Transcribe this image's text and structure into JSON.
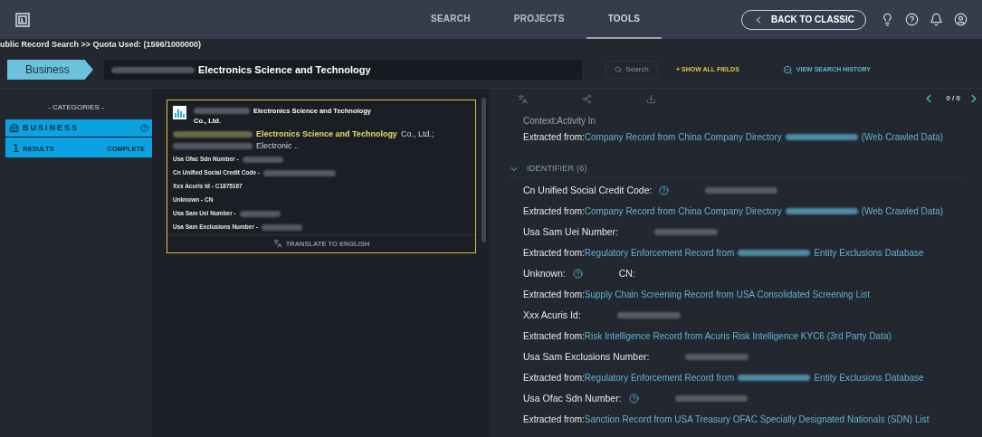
{
  "nav": {
    "tabs": [
      {
        "label": "SEARCH",
        "selected": false
      },
      {
        "label": "PROJECTS",
        "selected": false
      },
      {
        "label": "TOOLS",
        "selected": true
      }
    ],
    "back_button": "BACK TO CLASSIC"
  },
  "breadcrumb": "ublic Record Search >> Quota Used: (1596/1000000)",
  "search": {
    "category": "Business",
    "query": "Electronics Science and Technology",
    "query_redacted": true,
    "search_placeholder": "Search",
    "show_all_fields": "+ SHOW ALL FIELDS",
    "view_history": "VIEW SEARCH HISTORY"
  },
  "categories": {
    "title": "- CATEGORIES -",
    "items": [
      {
        "label": "BUSINESS",
        "count": "1",
        "count_label": "RESULTS",
        "status": "COMPLETE",
        "selected": true
      }
    ]
  },
  "result_card": {
    "title": "Electronics Science and Technology",
    "title_line2": "Co., Ltd.",
    "match": "Electronics Science and Technology",
    "match_suffix": "Co., Ltd.;",
    "match_line2": "Electronic ..",
    "fields": [
      {
        "label": "Usa Ofac Sdn Number -",
        "redacted": true
      },
      {
        "label": "Cn Unified Social Credit Code -",
        "redacted": true
      },
      {
        "label": "Xxx Acuris Id - C1875167",
        "redacted": false
      },
      {
        "label": "Unknown - CN",
        "redacted": false
      },
      {
        "label": "Usa Sam Uei Number -",
        "redacted": true
      },
      {
        "label": "Usa Sam Exclusions Number -",
        "redacted": true
      }
    ],
    "translate": "TRANSLATE TO ENGLISH",
    "selected": true
  },
  "details": {
    "pager": "0 / 0",
    "top_rows": [
      {
        "kind": "text",
        "label": "Context:Activity In"
      },
      {
        "kind": "source",
        "prefix": "Extracted from:",
        "link": "Company Record from China Company Directory",
        "redacted": true,
        "suffix": "(Web Crawled Data)"
      }
    ],
    "section": {
      "title": "IDENTIFIER (6)",
      "expanded": true
    },
    "rows": [
      {
        "kind": "field",
        "label": "Cn Unified Social Credit Code:",
        "help": true,
        "redacted": true
      },
      {
        "kind": "source",
        "prefix": "Extracted from:",
        "link": "Company Record from China Company Directory",
        "redacted": true,
        "suffix": "(Web Crawled Data)"
      },
      {
        "kind": "field",
        "label": "Usa Sam Uei Number:",
        "help": false,
        "redacted": true
      },
      {
        "kind": "source",
        "prefix": "Extracted from:",
        "link": "Regulatory Enforcement Record from",
        "redacted": true,
        "suffix": "Entity Exclusions Database"
      },
      {
        "kind": "field",
        "label": "Unknown:",
        "help": true,
        "redacted": false,
        "value": "CN:"
      },
      {
        "kind": "source",
        "prefix": "Extracted from:",
        "link": "Supply Chain Screening Record from USA Consolidated Screening List",
        "redacted": false
      },
      {
        "kind": "field",
        "label": "Xxx Acuris Id:",
        "help": false,
        "redacted": true
      },
      {
        "kind": "source",
        "prefix": "Extracted from:",
        "link": "Risk Intelligence Record from Acuris Risk Intelligence KYC6 (3rd Party Data)",
        "redacted": false
      },
      {
        "kind": "field",
        "label": "Usa Sam Exclusions Number:",
        "help": false,
        "redacted": true
      },
      {
        "kind": "source",
        "prefix": "Extracted from:",
        "link": "Regulatory Enforcement Record from",
        "redacted": true,
        "suffix": "Entity Exclusions Database"
      },
      {
        "kind": "field",
        "label": "Usa Ofac Sdn Number:",
        "help": true,
        "redacted": true
      },
      {
        "kind": "source",
        "prefix": "Extracted from:",
        "link": "Sanction Record from USA Treasury OFAC Specially Designated Nationals (SDN) List",
        "redacted": false
      }
    ]
  }
}
